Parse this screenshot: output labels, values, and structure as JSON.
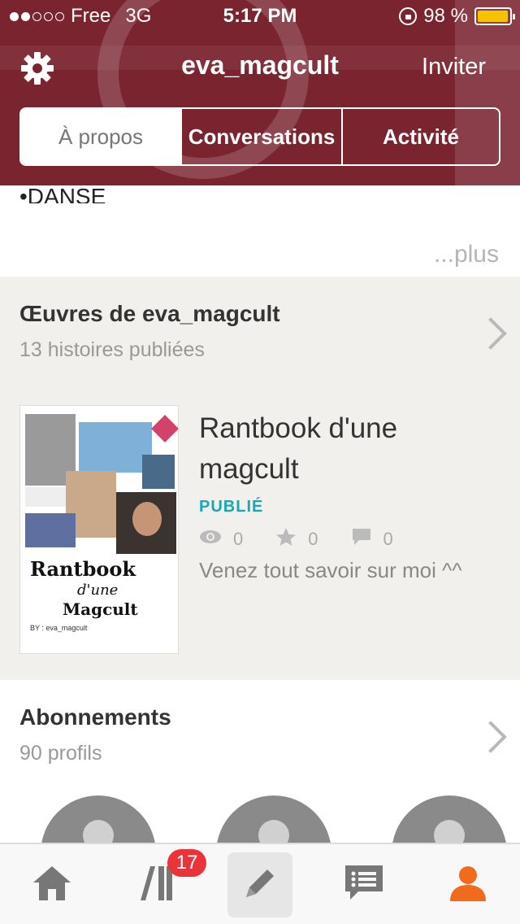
{
  "status_bar": {
    "carrier": "Free",
    "network": "3G",
    "time": "5:17 PM",
    "battery_percent": "98 %",
    "battery_level": 0.98,
    "signal_strength": 2,
    "signal_max": 5,
    "colors": {
      "battery": "#f5c400"
    }
  },
  "nav": {
    "title": "eva_magcult",
    "invite_label": "Inviter",
    "settings_icon": "gear-icon"
  },
  "tabs": {
    "items": [
      "À propos",
      "Conversations",
      "Activité"
    ],
    "selected": "À propos"
  },
  "about": {
    "visible_text": "•DANSE",
    "more_label": "...plus"
  },
  "works": {
    "title": "Œuvres de eva_magcult",
    "subtitle": "13 histoires publiées",
    "story": {
      "title": "Rantbook d'une magcult",
      "status": "PUBLIÉ",
      "reads": "0",
      "votes": "0",
      "comments": "0",
      "description": "Venez tout savoir sur moi ^^",
      "cover": {
        "line1": "Rantbook",
        "line2": "d'une",
        "line3": "Magcult",
        "byline": "BY : eva_magcult"
      }
    }
  },
  "following": {
    "title": "Abonnements",
    "subtitle": "90 profils"
  },
  "tabbar": {
    "items": [
      "home-icon",
      "library-icon",
      "write-icon",
      "messages-icon",
      "profile-icon"
    ],
    "library_badge": "17",
    "active": "profile-icon"
  },
  "colors": {
    "header": "#7a2430",
    "accent_orange": "#f26a1b",
    "published_teal": "#16a9b5",
    "badge_red": "#e9353a"
  }
}
